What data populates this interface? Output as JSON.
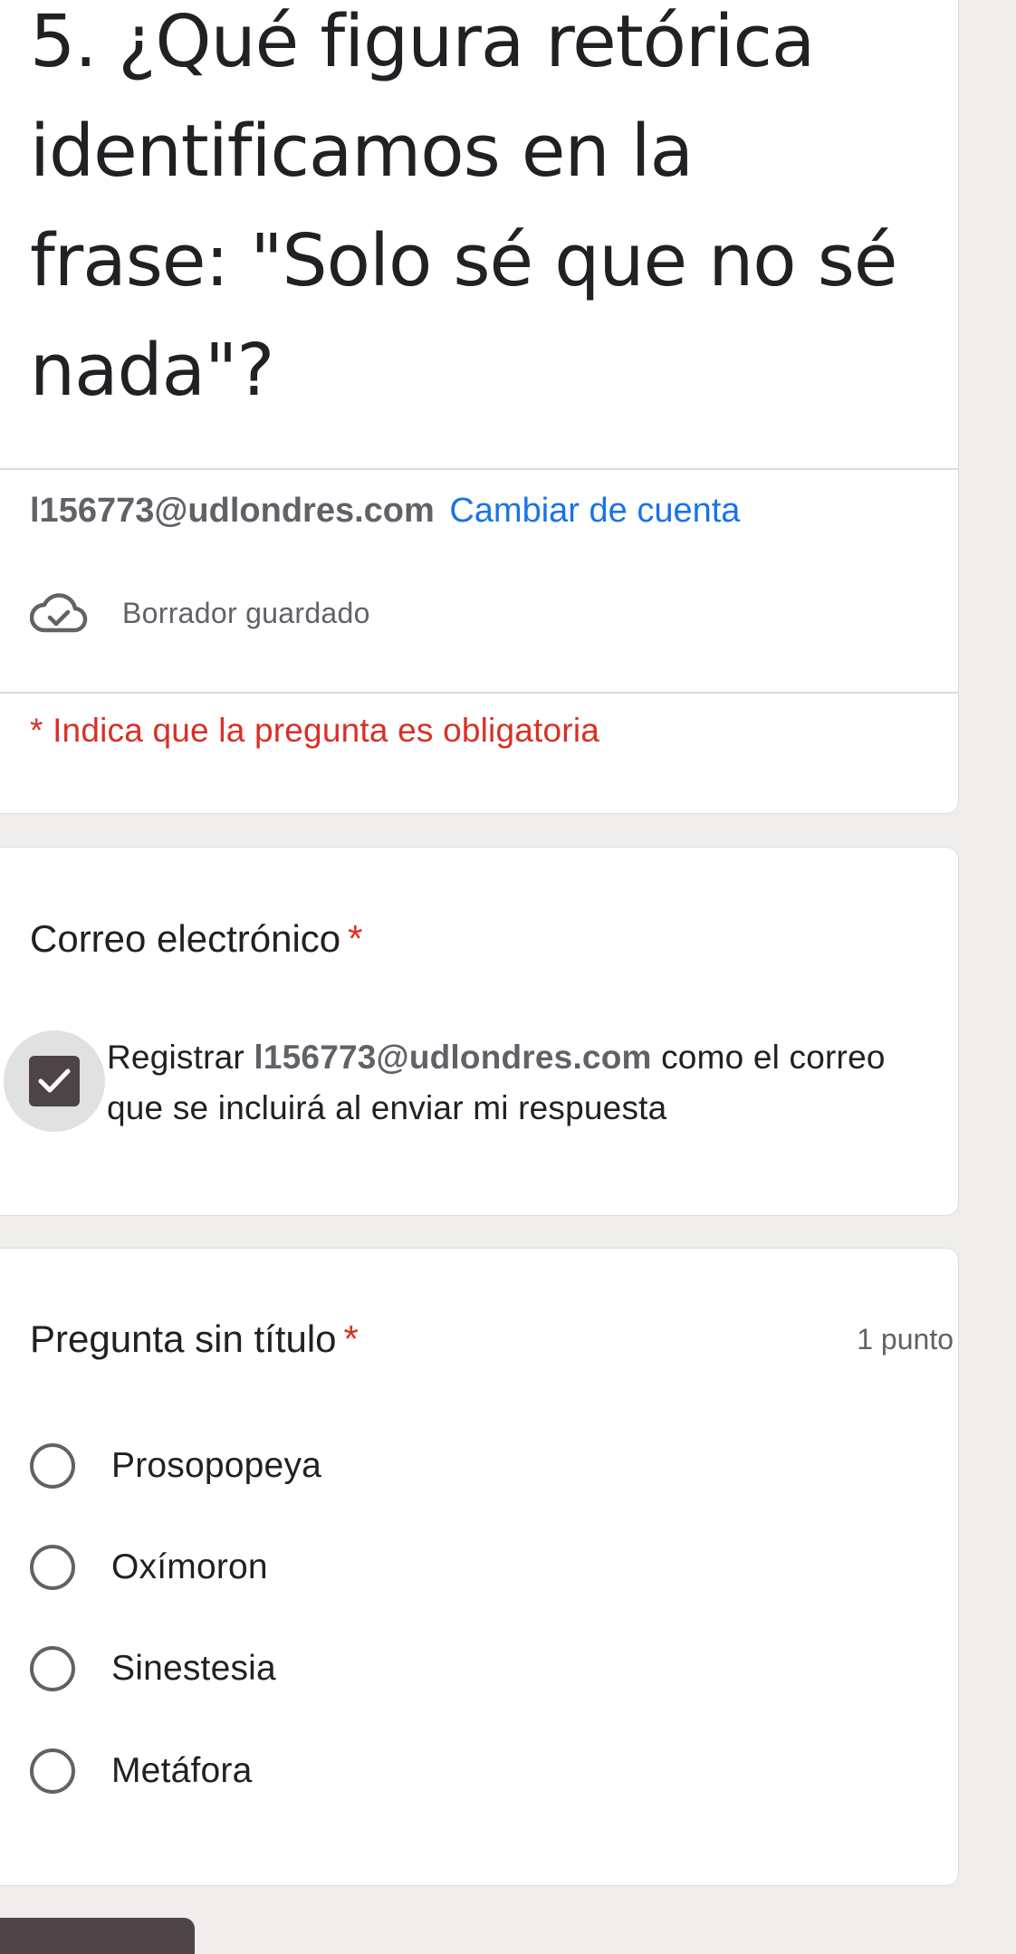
{
  "header": {
    "title": "5. ¿Qué figura retórica identificamos en la frase: \"Solo sé que no sé nada\"?",
    "account_email": "l156773@udlondres.com",
    "switch_account_label": "Cambiar de cuenta",
    "draft_status": "Borrador guardado",
    "draft_icon": "cloud-check-icon",
    "required_note": "* Indica que la pregunta es obligatoria"
  },
  "email_question": {
    "label": "Correo electrónico",
    "required_marker": "*",
    "checkbox_checked": true,
    "record_prefix": "Registrar",
    "record_email": "l156773@udlondres.com",
    "record_suffix": "como el correo que se incluirá al enviar mi respuesta"
  },
  "question": {
    "title": "Pregunta sin título",
    "required_marker": "*",
    "points": "1 punto",
    "options": [
      "Prosopopeya",
      "Oxímoron",
      "Sinestesia",
      "Metáfora"
    ]
  },
  "colors": {
    "accent_link": "#1a73e8",
    "required": "#d93025",
    "checkbox": "#4e4447",
    "background": "#efeeec"
  }
}
